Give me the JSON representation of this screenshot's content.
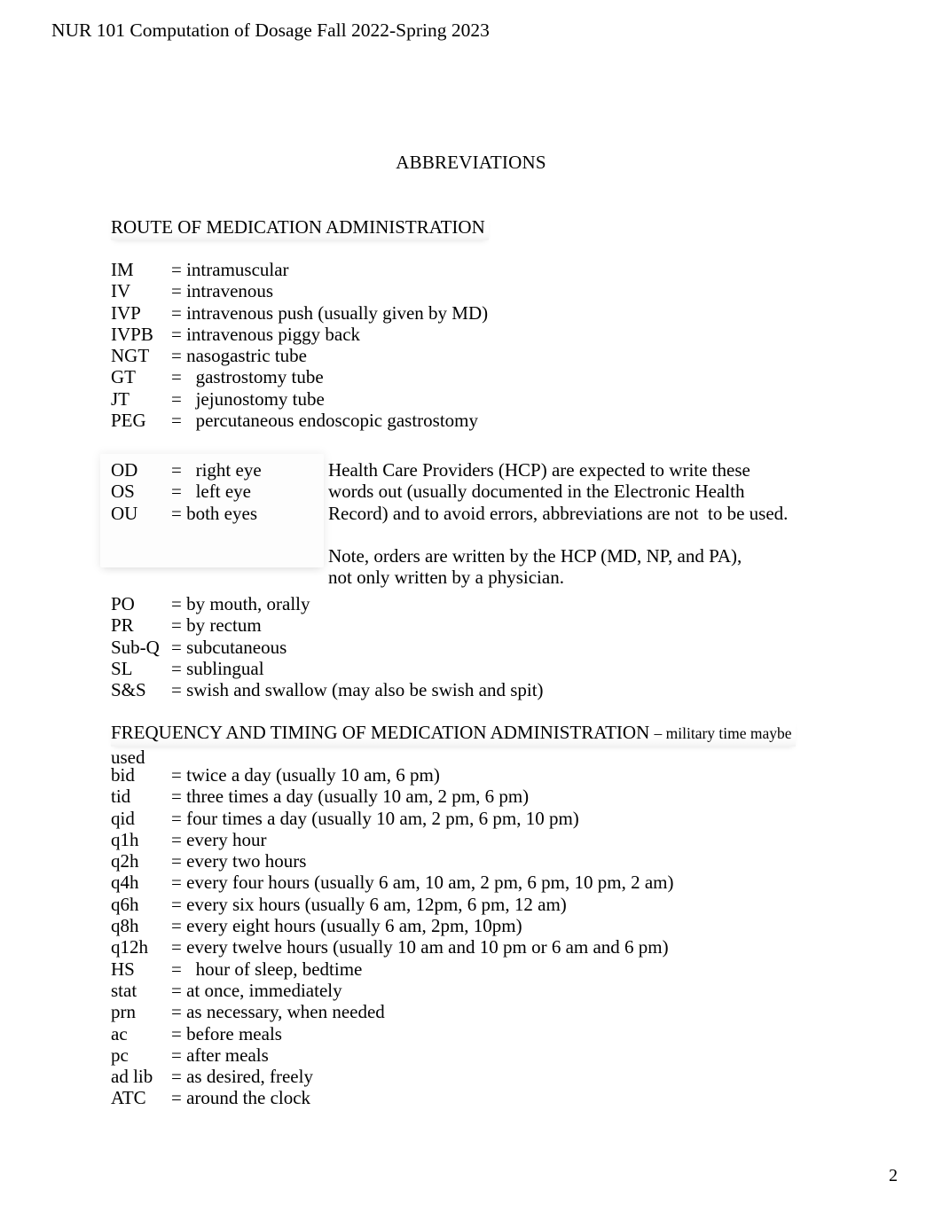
{
  "document": {
    "running_header": "NUR 101 Computation of Dosage Fall 2022-Spring 2023",
    "title": "ABBREVIATIONS",
    "page_number": "2"
  },
  "route_section": {
    "heading": "ROUTE OF MEDICATION ADMINISTRATION",
    "entries": [
      {
        "term": "IM",
        "definition": "= intramuscular"
      },
      {
        "term": "IV",
        "definition": "= intravenous"
      },
      {
        "term": "IVP",
        "definition": "= intravenous push (usually given by MD)"
      },
      {
        "term": "IVPB",
        "definition": "= intravenous piggy back"
      },
      {
        "term": "NGT",
        "definition": "= nasogastric tube"
      },
      {
        "term": "GT",
        "definition": "=   gastrostomy tube"
      },
      {
        "term": "JT",
        "definition": "=   jejunostomy tube"
      },
      {
        "term": "PEG",
        "definition": "=   percutaneous endoscopic gastrostomy"
      }
    ]
  },
  "eye_section": {
    "entries": [
      {
        "term": "OD",
        "definition": "=   right eye"
      },
      {
        "term": "OS",
        "definition": "=   left eye"
      },
      {
        "term": "OU",
        "definition": "= both eyes"
      }
    ]
  },
  "hcp_note": {
    "lines": [
      "Health Care Providers (HCP) are expected to write these",
      "words out (usually documented in the Electronic Health",
      "Record) and to avoid errors, abbreviations are not  to be used.",
      "Note, orders are written by the HCP (MD, NP, and PA),",
      "not only written by a physician."
    ]
  },
  "route_section_2": {
    "entries": [
      {
        "term": "PO",
        "definition": "= by mouth, orally"
      },
      {
        "term": "PR",
        "definition": "= by rectum"
      },
      {
        "term": "Sub-Q",
        "definition": "= subcutaneous"
      },
      {
        "term": "SL",
        "definition": "= sublingual"
      },
      {
        "term": "S&S",
        "definition": "= swish and swallow (may also be swish and spit)"
      }
    ]
  },
  "frequency_section": {
    "heading_main": "FREQUENCY AND TIMING OF MEDICATION ADMINISTRATION ",
    "heading_small": "– military time maybe",
    "heading_continuation": "used",
    "entries": [
      {
        "term": "bid",
        "definition": "= twice a day (usually 10 am, 6 pm)"
      },
      {
        "term": "tid",
        "definition": "= three times a day (usually 10 am, 2 pm, 6 pm)"
      },
      {
        "term": "qid",
        "definition": "= four times a day (usually 10 am, 2 pm, 6 pm, 10 pm)"
      },
      {
        "term": "q1h",
        "definition": "= every hour"
      },
      {
        "term": "q2h",
        "definition": "= every two hours"
      },
      {
        "term": "q4h",
        "definition": "= every four hours (usually 6 am, 10 am, 2 pm, 6 pm, 10 pm, 2 am)"
      },
      {
        "term": "q6h",
        "definition": "= every six hours (usually 6 am, 12pm, 6 pm, 12 am)"
      },
      {
        "term": "q8h",
        "definition": "= every eight hours (usually 6 am, 2pm, 10pm)"
      },
      {
        "term": "q12h",
        "definition": "= every twelve hours (usually 10 am and 10 pm or 6 am and 6 pm)"
      },
      {
        "term": "HS",
        "definition": "=   hour of sleep, bedtime"
      },
      {
        "term": "stat",
        "definition": "= at once, immediately"
      },
      {
        "term": "prn",
        "definition": "= as necessary, when needed"
      },
      {
        "term": "ac",
        "definition": "= before meals"
      },
      {
        "term": "pc",
        "definition": "= after meals"
      },
      {
        "term": "ad lib",
        "definition": "= as desired, freely"
      },
      {
        "term": "ATC",
        "definition": "= around the clock"
      }
    ]
  }
}
